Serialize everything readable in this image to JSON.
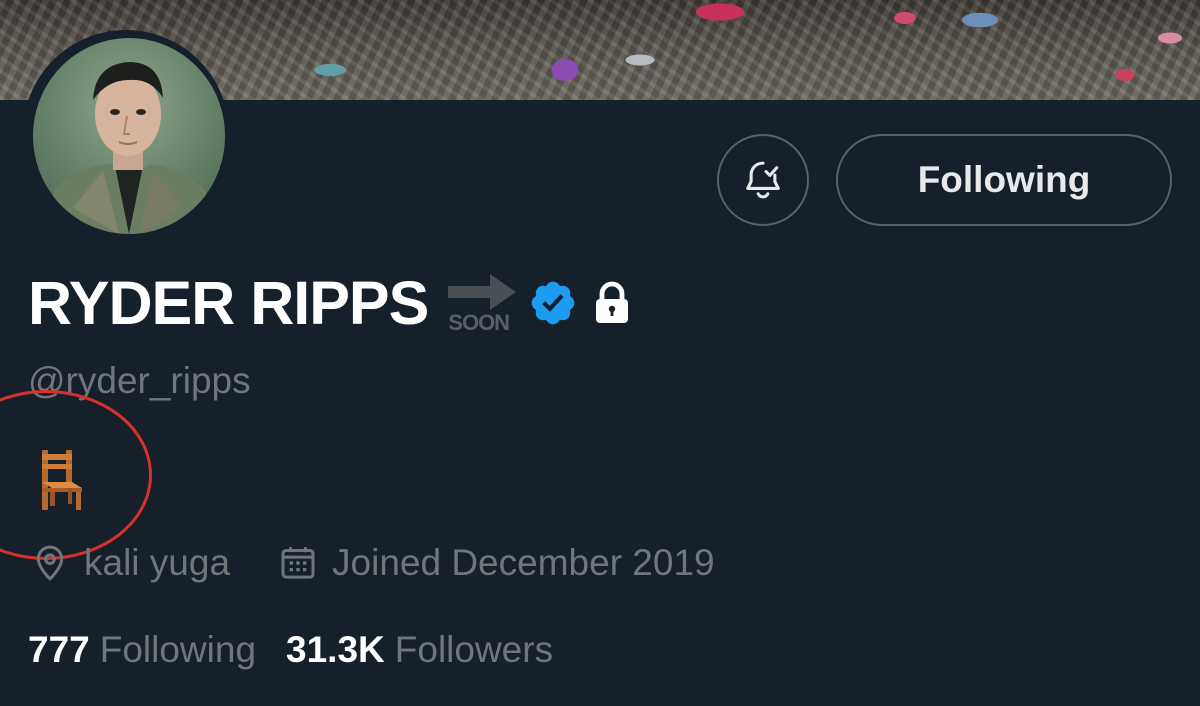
{
  "profile": {
    "display_name": "RYDER RIPPS",
    "soon_text": "SOON",
    "handle": "@ryder_ripps",
    "bio_emoji": "chair",
    "location": "kali yuga",
    "joined": "Joined December 2019"
  },
  "actions": {
    "following_label": "Following"
  },
  "stats": {
    "following_count": "777",
    "following_label": "Following",
    "followers_count": "31.3K",
    "followers_label": "Followers"
  },
  "colors": {
    "background": "#15202b",
    "verified_blue": "#1d9bf0",
    "muted_text": "#71767b",
    "highlight_circle": "#d8312d"
  }
}
